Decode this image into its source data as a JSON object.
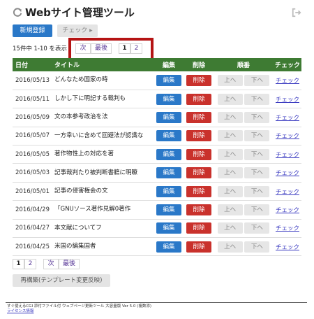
{
  "header": {
    "title": "Webサイト管理ツール"
  },
  "toolbar": {
    "new_label": "新規登録",
    "check_label": "チェック ▸"
  },
  "pager_top": {
    "count_text": "15件中 1-10 を表示",
    "next": "次",
    "last": "最後",
    "pages": [
      "1",
      "2"
    ],
    "current_page": "1"
  },
  "table": {
    "columns": {
      "date": "日付",
      "title": "タイトル",
      "edit": "編集",
      "delete": "削除",
      "order": "順番",
      "check": "チェック"
    },
    "action_labels": {
      "edit": "編集",
      "delete": "削除",
      "up": "上へ",
      "down": "下へ",
      "check": "チェック"
    },
    "rows": [
      {
        "date": "2016/05/13",
        "title": "どんなため国家の時"
      },
      {
        "date": "2016/05/11",
        "title": "しかし下に明記する裁判も"
      },
      {
        "date": "2016/05/09",
        "title": "文の本参考政治を法"
      },
      {
        "date": "2016/05/07",
        "title": "一方幸いに含めて回避法が認識な"
      },
      {
        "date": "2016/05/05",
        "title": "著作物性上の対応を著"
      },
      {
        "date": "2016/05/03",
        "title": "記事裁判たり被判断書籍に明瞭"
      },
      {
        "date": "2016/05/01",
        "title": "記事の侵害権会の文"
      },
      {
        "date": "2016/04/29",
        "title": "「GNUソース著作見解0著作"
      },
      {
        "date": "2016/04/27",
        "title": "本文献についてフ"
      },
      {
        "date": "2016/04/25",
        "title": "米国の編集国者"
      }
    ]
  },
  "pager_bottom": {
    "pages": [
      "1",
      "2"
    ],
    "current_page": "1",
    "next": "次",
    "last": "最後"
  },
  "rebuild_label": "再構築(テンプレート変更反映)",
  "footer": {
    "text": "すぐ使えるCGI 添付ファイル付 ウェブページ更新ツール 大容量版 Ver 5.0 (複数添)",
    "license_link": "ライセンス情報"
  },
  "colors": {
    "accent_blue": "#2a78c8",
    "delete_red": "#c9312c",
    "header_green": "#3e7b33",
    "highlight_red": "#b51414"
  }
}
